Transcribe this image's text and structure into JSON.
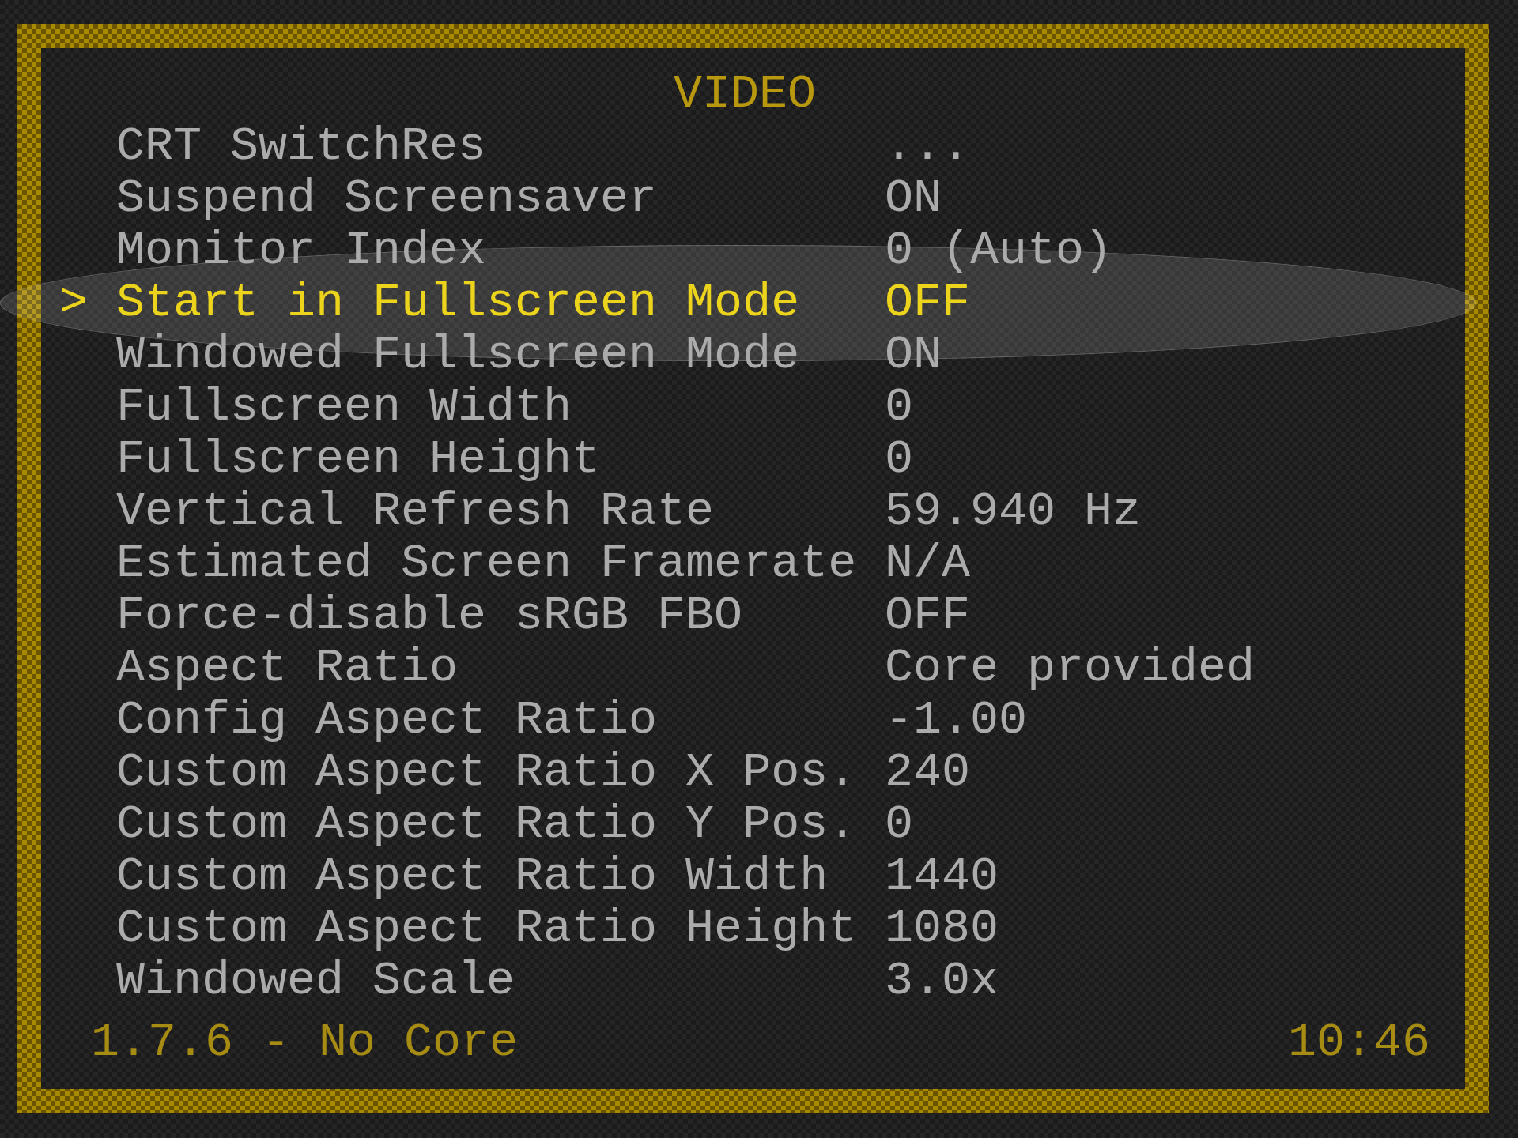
{
  "title": "VIDEO",
  "cursor": ">",
  "items": [
    {
      "label": "CRT SwitchRes",
      "value": "...",
      "selected": false
    },
    {
      "label": "Suspend Screensaver",
      "value": "ON",
      "selected": false
    },
    {
      "label": "Monitor Index",
      "value": "0 (Auto)",
      "selected": false
    },
    {
      "label": "Start in Fullscreen Mode",
      "value": "OFF",
      "selected": true
    },
    {
      "label": "Windowed Fullscreen Mode",
      "value": "ON",
      "selected": false
    },
    {
      "label": "Fullscreen Width",
      "value": "0",
      "selected": false
    },
    {
      "label": "Fullscreen Height",
      "value": "0",
      "selected": false
    },
    {
      "label": "Vertical Refresh Rate",
      "value": "59.940 Hz",
      "selected": false
    },
    {
      "label": "Estimated Screen Framerate",
      "value": "N/A",
      "selected": false
    },
    {
      "label": "Force-disable sRGB FBO",
      "value": "OFF",
      "selected": false
    },
    {
      "label": "Aspect Ratio",
      "value": "Core provided",
      "selected": false
    },
    {
      "label": "Config Aspect Ratio",
      "value": "-1.00",
      "selected": false
    },
    {
      "label": "Custom Aspect Ratio X Pos.",
      "value": "240",
      "selected": false
    },
    {
      "label": "Custom Aspect Ratio Y Pos.",
      "value": "0",
      "selected": false
    },
    {
      "label": "Custom Aspect Ratio Width",
      "value": "1440",
      "selected": false
    },
    {
      "label": "Custom Aspect Ratio Height",
      "value": "1080",
      "selected": false
    },
    {
      "label": "Windowed Scale",
      "value": "3.0x",
      "selected": false
    }
  ],
  "footer": {
    "version": "1.7.6 - No Core",
    "clock": "10:46"
  }
}
